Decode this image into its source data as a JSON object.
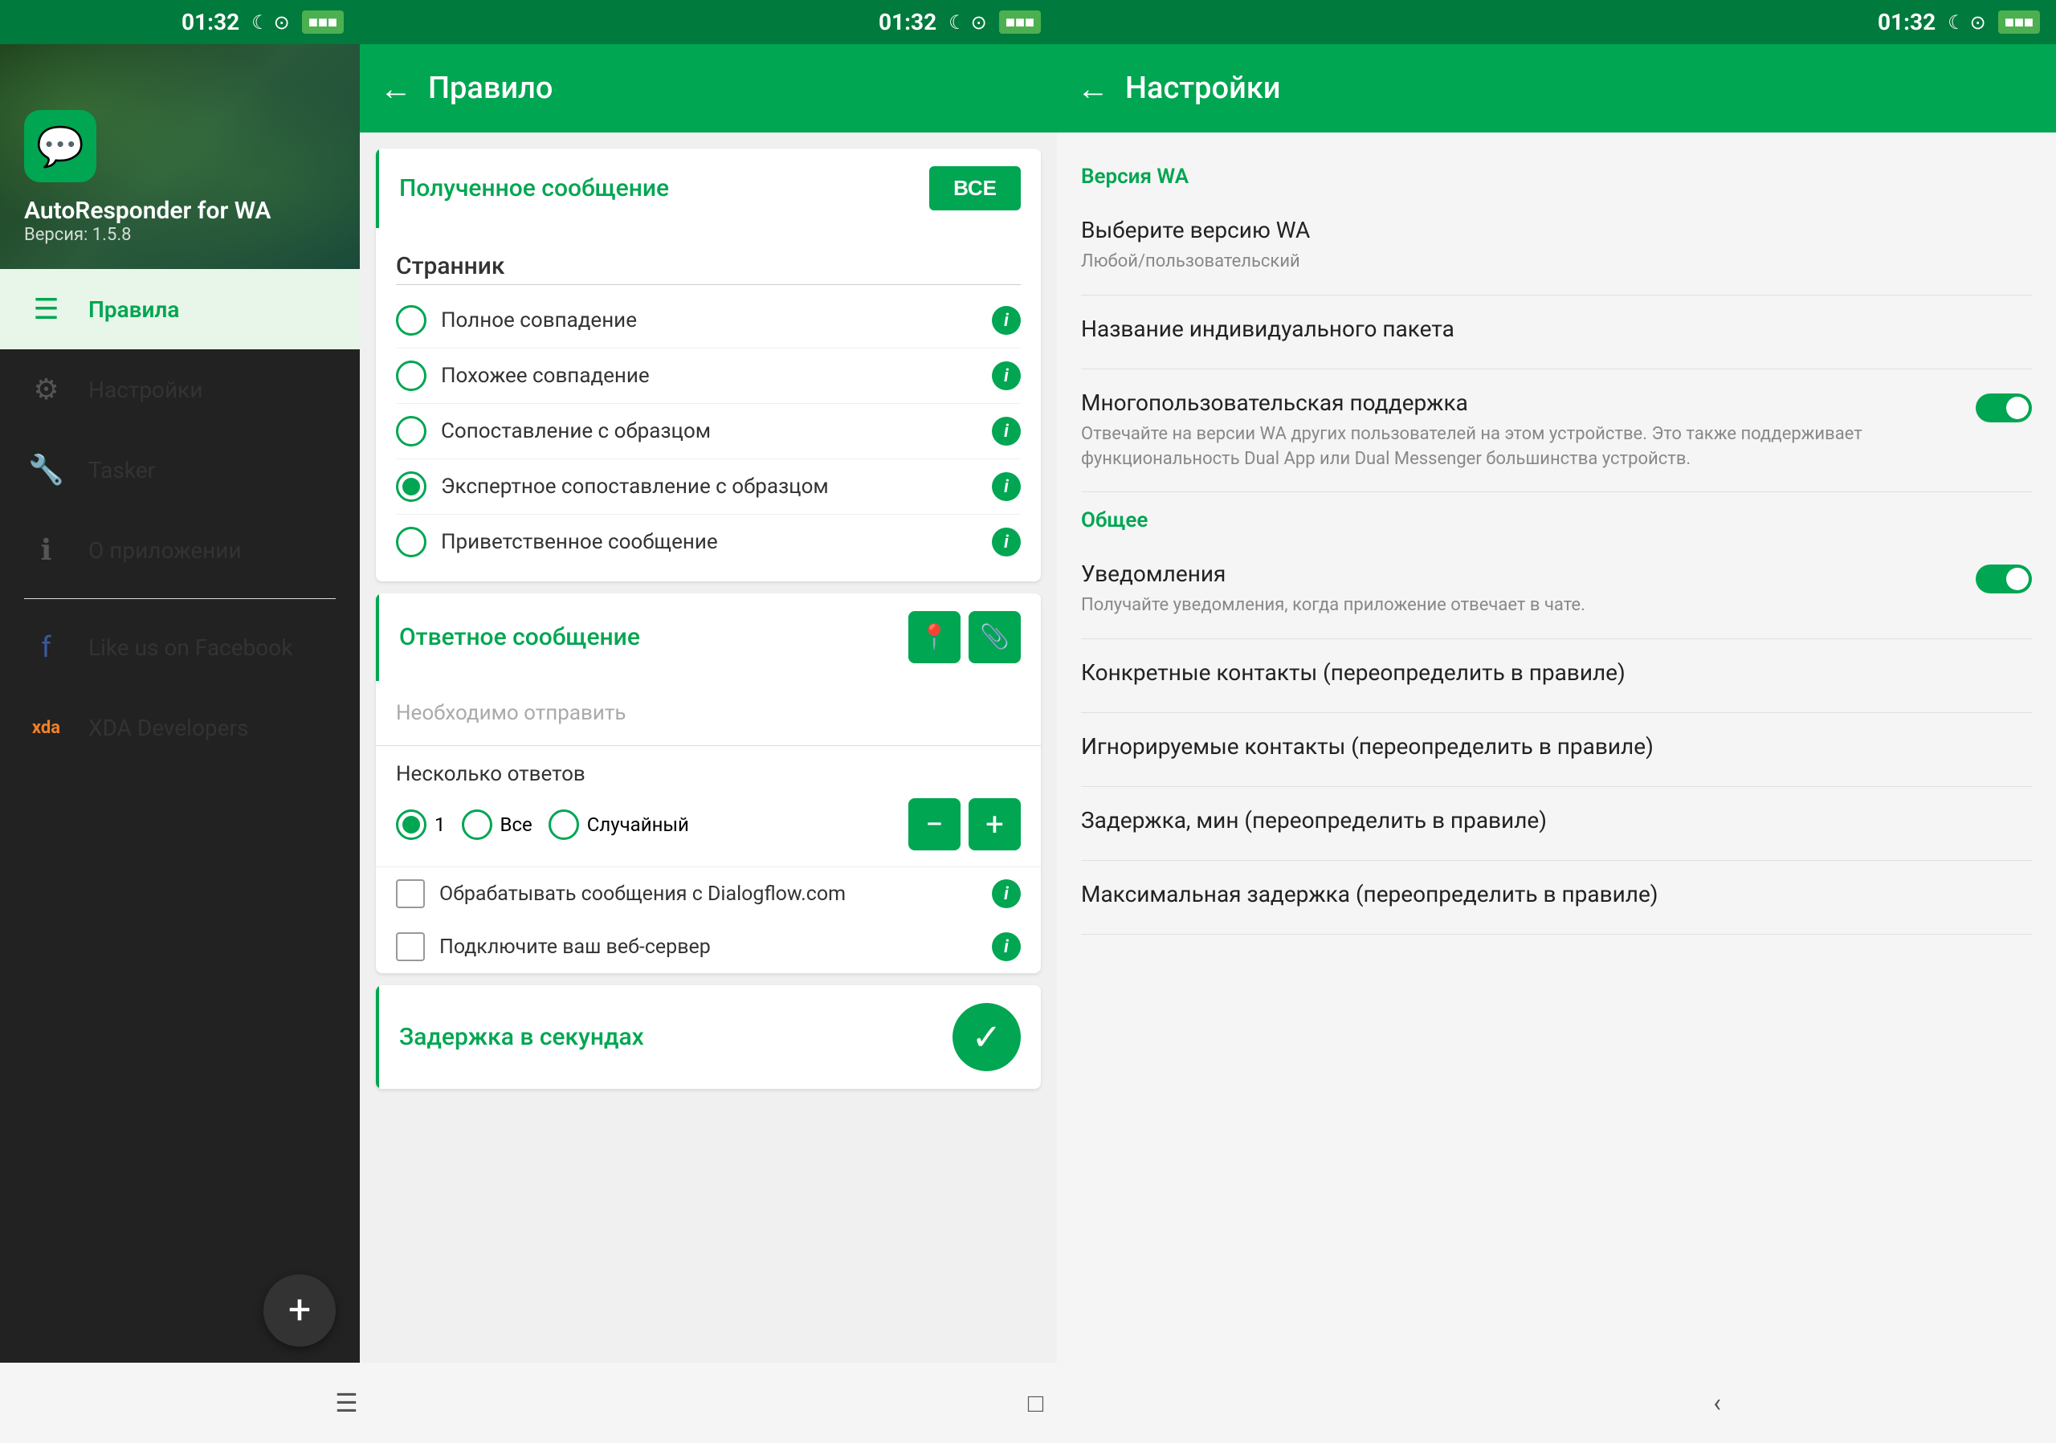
{
  "panel1": {
    "status_bar": {
      "time": "01:32",
      "icons": "☾ ⊙ 🔵"
    },
    "app_name": "AutoResponder for WA",
    "version": "Версия: 1.5.8",
    "nav_items": [
      {
        "id": "rules",
        "label": "Правила",
        "active": true
      },
      {
        "id": "settings",
        "label": "Настройки",
        "active": false
      },
      {
        "id": "tasker",
        "label": "Tasker",
        "active": false
      },
      {
        "id": "about",
        "label": "О приложении",
        "active": false
      },
      {
        "id": "facebook",
        "label": "Like us on Facebook",
        "active": false
      },
      {
        "id": "xda",
        "label": "XDA Developers",
        "active": false
      }
    ],
    "fab_label": "+",
    "bottom_nav": [
      "☰",
      "□",
      "‹"
    ]
  },
  "panel2": {
    "status_bar": {
      "time": "01:32"
    },
    "title": "Правило",
    "back_icon": "←",
    "received_message": {
      "header": "Полученное сообщение",
      "button": "ВСЕ",
      "section_name": "Странник",
      "options": [
        {
          "label": "Полное совпадение",
          "selected": false
        },
        {
          "label": "Похожее совпадение",
          "selected": false
        },
        {
          "label": "Сопоставление с образцом",
          "selected": false
        },
        {
          "label": "Экспертное сопоставление с образцом",
          "selected": true
        },
        {
          "label": "Приветственное сообщение",
          "selected": false
        }
      ]
    },
    "response_message": {
      "header": "Ответное сообщение",
      "placeholder": "Необходимо отправить"
    },
    "multiple_answers": {
      "title": "Несколько ответов",
      "options": [
        "1",
        "Все",
        "Случайный"
      ]
    },
    "checkboxes": [
      {
        "label": "Обрабатывать сообщения с Dialogflow.com"
      },
      {
        "label": "Подключите ваш веб-сервер"
      }
    ],
    "delay": {
      "header": "Задержка в секундах"
    },
    "bottom_nav": [
      "☰",
      "□",
      "‹"
    ]
  },
  "panel3": {
    "status_bar": {
      "time": "01:32"
    },
    "title": "Настройки",
    "back_icon": "←",
    "sections": [
      {
        "title": "Версия WA",
        "items": [
          {
            "type": "setting",
            "title": "Выберите версию WA",
            "subtitle": "Любой/пользовательский",
            "has_toggle": false
          },
          {
            "type": "setting",
            "title": "Название индивидуального пакета",
            "subtitle": "",
            "has_toggle": false
          },
          {
            "type": "setting_toggle",
            "title": "Многопользовательская поддержка",
            "subtitle": "Отвечайте на версии WA других пользователей на этом устройстве. Это также поддерживает функциональность Dual App или Dual Messenger большинства устройств.",
            "has_toggle": true,
            "toggle_on": true
          }
        ]
      },
      {
        "title": "Общее",
        "items": [
          {
            "type": "setting_toggle",
            "title": "Уведомления",
            "subtitle": "Получайте уведомления, когда приложение отвечает в чате.",
            "has_toggle": true,
            "toggle_on": true
          },
          {
            "type": "setting",
            "title": "Конкретные контакты (переопределить в правиле)",
            "subtitle": "",
            "has_toggle": false
          },
          {
            "type": "setting",
            "title": "Игнорируемые контакты (переопределить в правиле)",
            "subtitle": "",
            "has_toggle": false
          },
          {
            "type": "setting",
            "title": "Задержка, мин (переопределить в правиле)",
            "subtitle": "",
            "has_toggle": false
          },
          {
            "type": "setting",
            "title": "Максимальная задержка (переопределить в правиле)",
            "subtitle": "",
            "has_toggle": false
          }
        ]
      }
    ],
    "bottom_nav": [
      "☰",
      "□",
      "‹"
    ]
  }
}
